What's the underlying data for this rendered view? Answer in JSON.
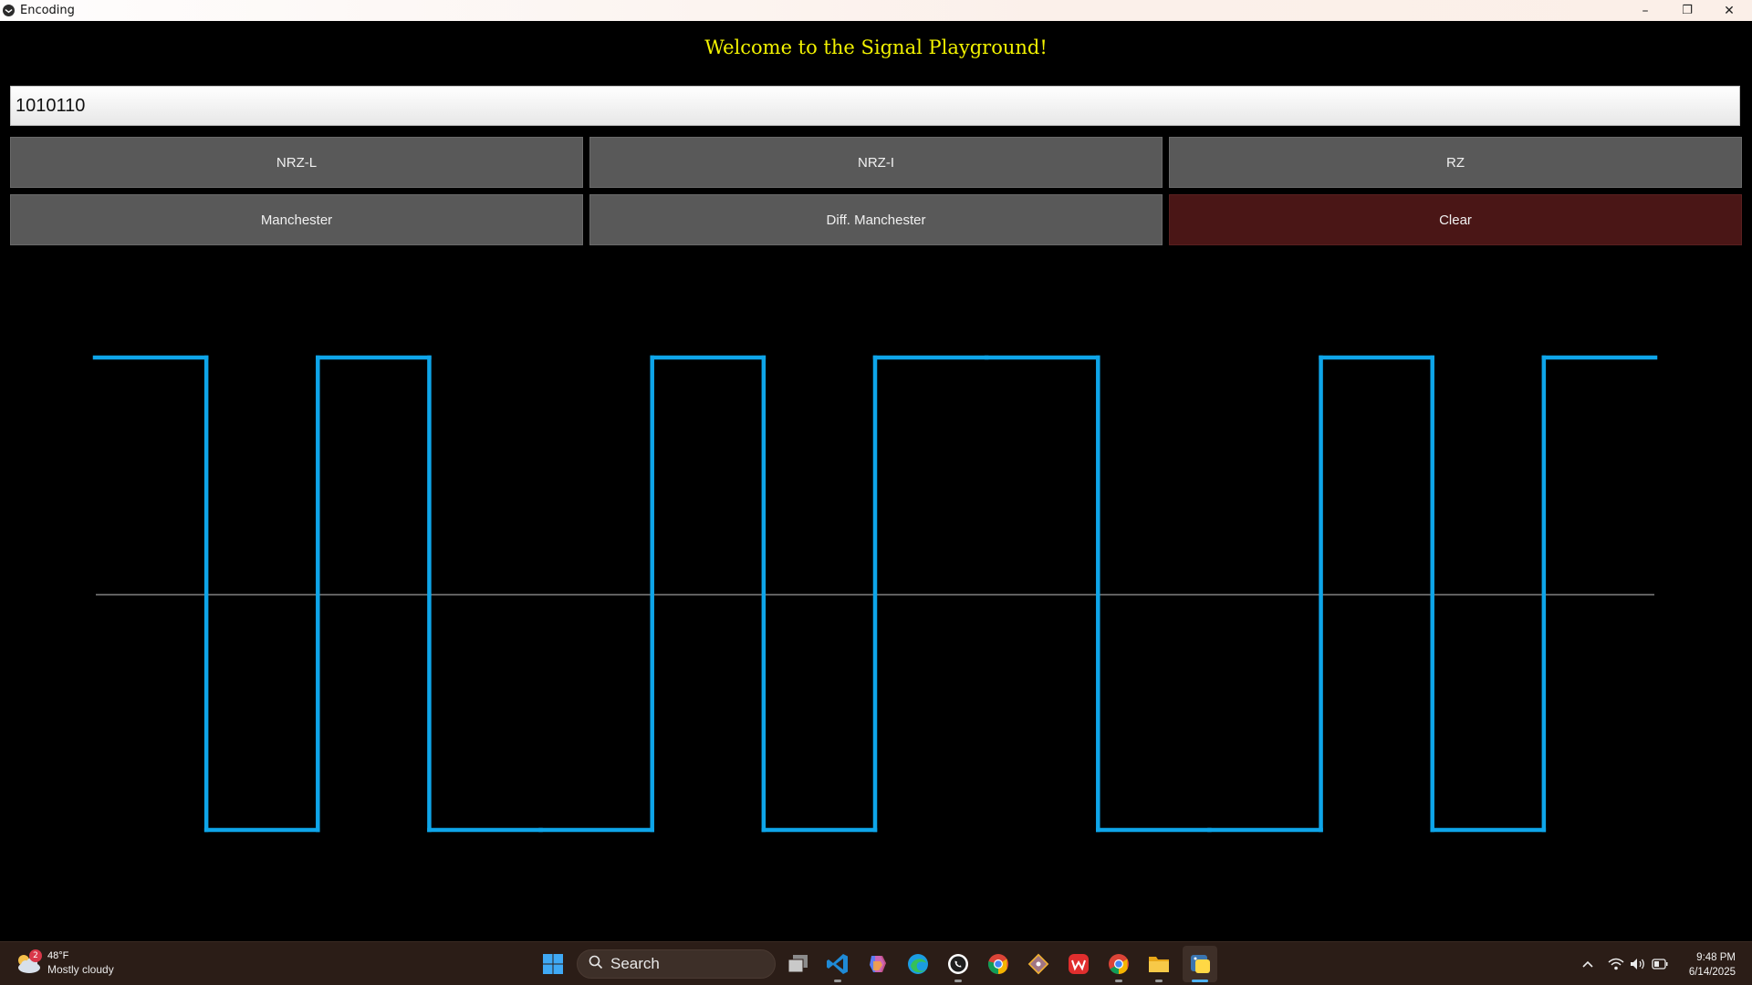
{
  "window": {
    "title": "Encoding",
    "controls": {
      "minimize": "–",
      "maximize": "❐",
      "close": "✕"
    }
  },
  "app": {
    "welcome": "Welcome to the Signal Playground!",
    "input_value": "1010110",
    "buttons": {
      "nrzl": "NRZ-L",
      "nrzi": "NRZ-I",
      "rz": "RZ",
      "manchester": "Manchester",
      "diff_manchester": "Diff. Manchester",
      "clear": "Clear"
    }
  },
  "chart_data": {
    "type": "line",
    "title": "",
    "xlabel": "",
    "ylabel": "",
    "series": [
      {
        "levels": [
          1,
          -1,
          1,
          -1,
          -1,
          1,
          -1,
          1,
          1,
          -1,
          -1,
          1,
          -1,
          1
        ],
        "step": "half-bit"
      }
    ],
    "ylim": [
      -1,
      1
    ],
    "grid": false,
    "colors": {
      "signal": "#0ea5e9",
      "baseline": "#9a9a9a"
    }
  },
  "taskbar": {
    "weather": {
      "temp": "48°F",
      "condition": "Mostly cloudy",
      "badge": "2"
    },
    "search_label": "Search",
    "clock": {
      "time": "9:48 PM",
      "date": "6/14/2025"
    },
    "icons": [
      "windows-start-icon",
      "task-view-icon",
      "vscode-icon",
      "copilot-icon",
      "edge-icon",
      "whatsapp-icon",
      "chrome-icon",
      "git-icon",
      "wps-icon",
      "chrome-icon",
      "file-explorer-icon",
      "python-icon"
    ]
  }
}
